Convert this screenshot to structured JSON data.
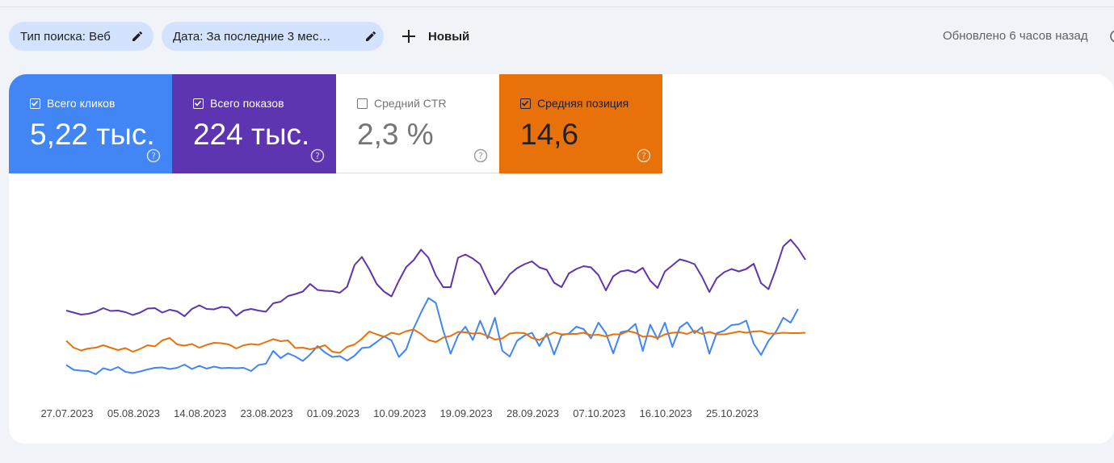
{
  "filters": {
    "search_type": "Тип поиска: Веб",
    "date": "Дата: За последние 3 мес…",
    "new_label": "Новый"
  },
  "status": {
    "updated": "Обновлено 6 часов назад"
  },
  "metrics": [
    {
      "label": "Всего кликов",
      "value": "5,22 тыс.",
      "checked": true,
      "color": "#4285f4"
    },
    {
      "label": "Всего показов",
      "value": "224 тыс.",
      "checked": true,
      "color": "#5e35b1"
    },
    {
      "label": "Средний CTR",
      "value": "2,3 %",
      "checked": false,
      "color": "#ffffff"
    },
    {
      "label": "Средняя позиция",
      "value": "14,6",
      "checked": true,
      "color": "#e8710a"
    }
  ],
  "chart_data": {
    "type": "line",
    "x_start": "2023-07-27",
    "x_ticks": [
      "27.07.2023",
      "05.08.2023",
      "14.08.2023",
      "23.08.2023",
      "01.09.2023",
      "10.09.2023",
      "19.09.2023",
      "28.09.2023",
      "07.10.2023",
      "16.10.2023",
      "25.10.2023"
    ],
    "grid": false,
    "legend": "none",
    "series": [
      {
        "name": "Всего кликов",
        "color": "#4285f4",
        "values": [
          19,
          7,
          5,
          4,
          -4,
          11,
          6,
          14,
          2,
          -1,
          3,
          8,
          12,
          13,
          9,
          12,
          20,
          9,
          17,
          10,
          15,
          11,
          12,
          11,
          12,
          4,
          19,
          22,
          54,
          36,
          48,
          40,
          29,
          45,
          66,
          50,
          39,
          41,
          30,
          42,
          61,
          63,
          76,
          90,
          80,
          39,
          58,
          110,
          149,
          185,
          173,
          104,
          47,
          92,
          114,
          81,
          129,
          85,
          136,
          54,
          40,
          79,
          92,
          99,
          66,
          97,
          45,
          93,
          97,
          114,
          108,
          85,
          124,
          98,
          48,
          100,
          104,
          121,
          54,
          119,
          83,
          124,
          64,
          112,
          125,
          98,
          113,
          47,
          98,
          104,
          118,
          120,
          129,
          72,
          44,
          79,
          101,
          136,
          124,
          158
        ]
      },
      {
        "name": "Всего показов",
        "color": "#5e35b1",
        "values": [
          154,
          149,
          144,
          146,
          151,
          160,
          153,
          154,
          150,
          143,
          149,
          159,
          160,
          149,
          156,
          152,
          140,
          158,
          167,
          158,
          157,
          163,
          161,
          141,
          154,
          158,
          154,
          151,
          172,
          176,
          190,
          195,
          201,
          220,
          205,
          203,
          202,
          198,
          213,
          267,
          287,
          256,
          220,
          201,
          189,
          228,
          262,
          279,
          305,
          285,
          241,
          212,
          212,
          285,
          293,
          283,
          269,
          229,
          194,
          217,
          244,
          259,
          269,
          276,
          261,
          255,
          223,
          212,
          246,
          257,
          264,
          261,
          242,
          204,
          239,
          251,
          254,
          248,
          260,
          228,
          210,
          251,
          266,
          281,
          276,
          269,
          238,
          200,
          234,
          249,
          257,
          251,
          257,
          270,
          222,
          207,
          256,
          313,
          330,
          308,
          280
        ]
      },
      {
        "name": "Средняя позиция",
        "color": "#e8710a",
        "values": [
          79,
          62,
          55,
          60,
          62,
          68,
          62,
          56,
          61,
          52,
          59,
          68,
          65,
          80,
          86,
          70,
          67,
          71,
          62,
          69,
          74,
          73,
          70,
          60,
          68,
          71,
          69,
          76,
          83,
          78,
          80,
          61,
          62,
          58,
          62,
          68,
          52,
          49,
          64,
          70,
          84,
          102,
          95,
          89,
          99,
          95,
          103,
          107,
          96,
          81,
          76,
          87,
          91,
          101,
          100,
          97,
          98,
          91,
          82,
          85,
          97,
          99,
          98,
          86,
          81,
          91,
          100,
          95,
          96,
          96,
          99,
          93,
          94,
          90,
          95,
          95,
          103,
          99,
          89,
          91,
          86,
          95,
          99,
          100,
          96,
          104,
          96,
          101,
          95,
          95,
          98,
          102,
          99,
          102,
          103,
          97,
          97,
          99,
          98,
          98,
          99
        ]
      }
    ]
  }
}
